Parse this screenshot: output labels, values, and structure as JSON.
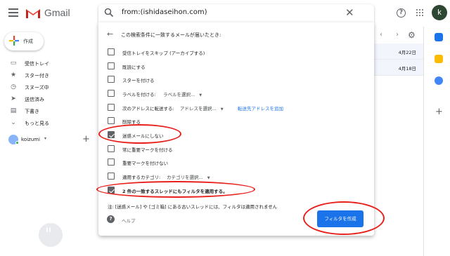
{
  "header": {
    "brand": "Gmail",
    "search_query": "from:(ishidaseihon.com)",
    "close_symbol": "✕",
    "help_symbol": "?",
    "avatar_letter": "k"
  },
  "compose": {
    "label": "作成"
  },
  "sidebar": {
    "items": [
      {
        "icon": "inbox-icon",
        "glyph": "▭",
        "label": "受信トレイ"
      },
      {
        "icon": "star-icon",
        "glyph": "★",
        "label": "スター付き"
      },
      {
        "icon": "clock-icon",
        "glyph": "◷",
        "label": "スヌーズ中"
      },
      {
        "icon": "send-icon",
        "glyph": "➤",
        "label": "送信済み"
      },
      {
        "icon": "draft-icon",
        "glyph": "▤",
        "label": "下書き"
      },
      {
        "icon": "chevron-down-icon",
        "glyph": "⌄",
        "label": "もっと見る"
      }
    ],
    "user": {
      "name": "koizumi",
      "caret": "▾",
      "add": "+"
    }
  },
  "mail_list": {
    "prev": "‹",
    "next": "›",
    "settings": "⚙",
    "dates": [
      "4月22日",
      "4月18日"
    ]
  },
  "filter_panel": {
    "back": "←",
    "heading": "この検索条件に一致するメールが届いたとき:",
    "options": {
      "skip_inbox": "受信トレイをスキップ (アーカイブする)",
      "mark_read": "既読にする",
      "star": "スターを付ける",
      "apply_label": "ラベルを付ける:",
      "apply_label_select": "ラベルを選択...",
      "forward": "次のアドレスに転送する:",
      "forward_select": "アドレスを選択...",
      "forward_link": "転送先アドレスを追加",
      "delete": "削除する",
      "never_spam": "迷惑メールにしない",
      "always_important": "常に重要マークを付ける",
      "never_important": "重要マークを付けない",
      "categorize": "適用するカテゴリ:",
      "categorize_select": "カテゴリを選択...",
      "also_apply": "2 件の一致するスレッドにもフィルタを適用する。"
    },
    "checked": {
      "skip_inbox": false,
      "mark_read": false,
      "star": false,
      "apply_label": false,
      "forward": false,
      "delete": false,
      "never_spam": true,
      "always_important": false,
      "never_important": false,
      "categorize": false,
      "also_apply": true
    },
    "note": "注: [迷惑メール] や [ゴミ箱] にある古いスレッドには、フィルタは適用されません",
    "help": "ヘルプ",
    "create_button": "フィルタを作成"
  },
  "colors": {
    "accent": "#1a73e8",
    "annotation": "#e8201c",
    "checkbox": "#5f6368"
  }
}
